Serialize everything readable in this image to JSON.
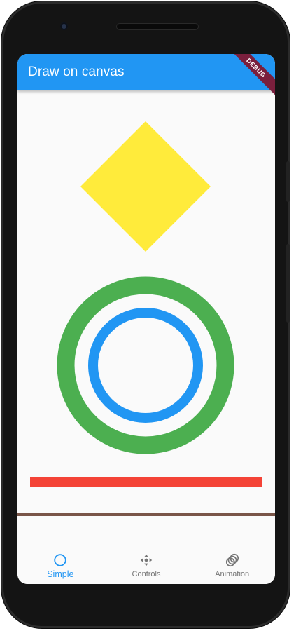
{
  "app": {
    "title": "Draw on canvas",
    "debug_banner": "DEBUG"
  },
  "colors": {
    "appbar": "#2196f3",
    "diamond": "#ffeb3b",
    "outer_ring": "#4caf50",
    "inner_ring": "#2196f3",
    "red_bar": "#f44336",
    "brown_line": "#795548",
    "nav_active": "#2196f3",
    "nav_inactive": "#757575"
  },
  "bottom_nav": {
    "items": [
      {
        "label": "Simple",
        "icon": "circle-outline-icon",
        "active": true
      },
      {
        "label": "Controls",
        "icon": "move-arrows-icon",
        "active": false
      },
      {
        "label": "Animation",
        "icon": "animation-icon",
        "active": false
      }
    ]
  }
}
